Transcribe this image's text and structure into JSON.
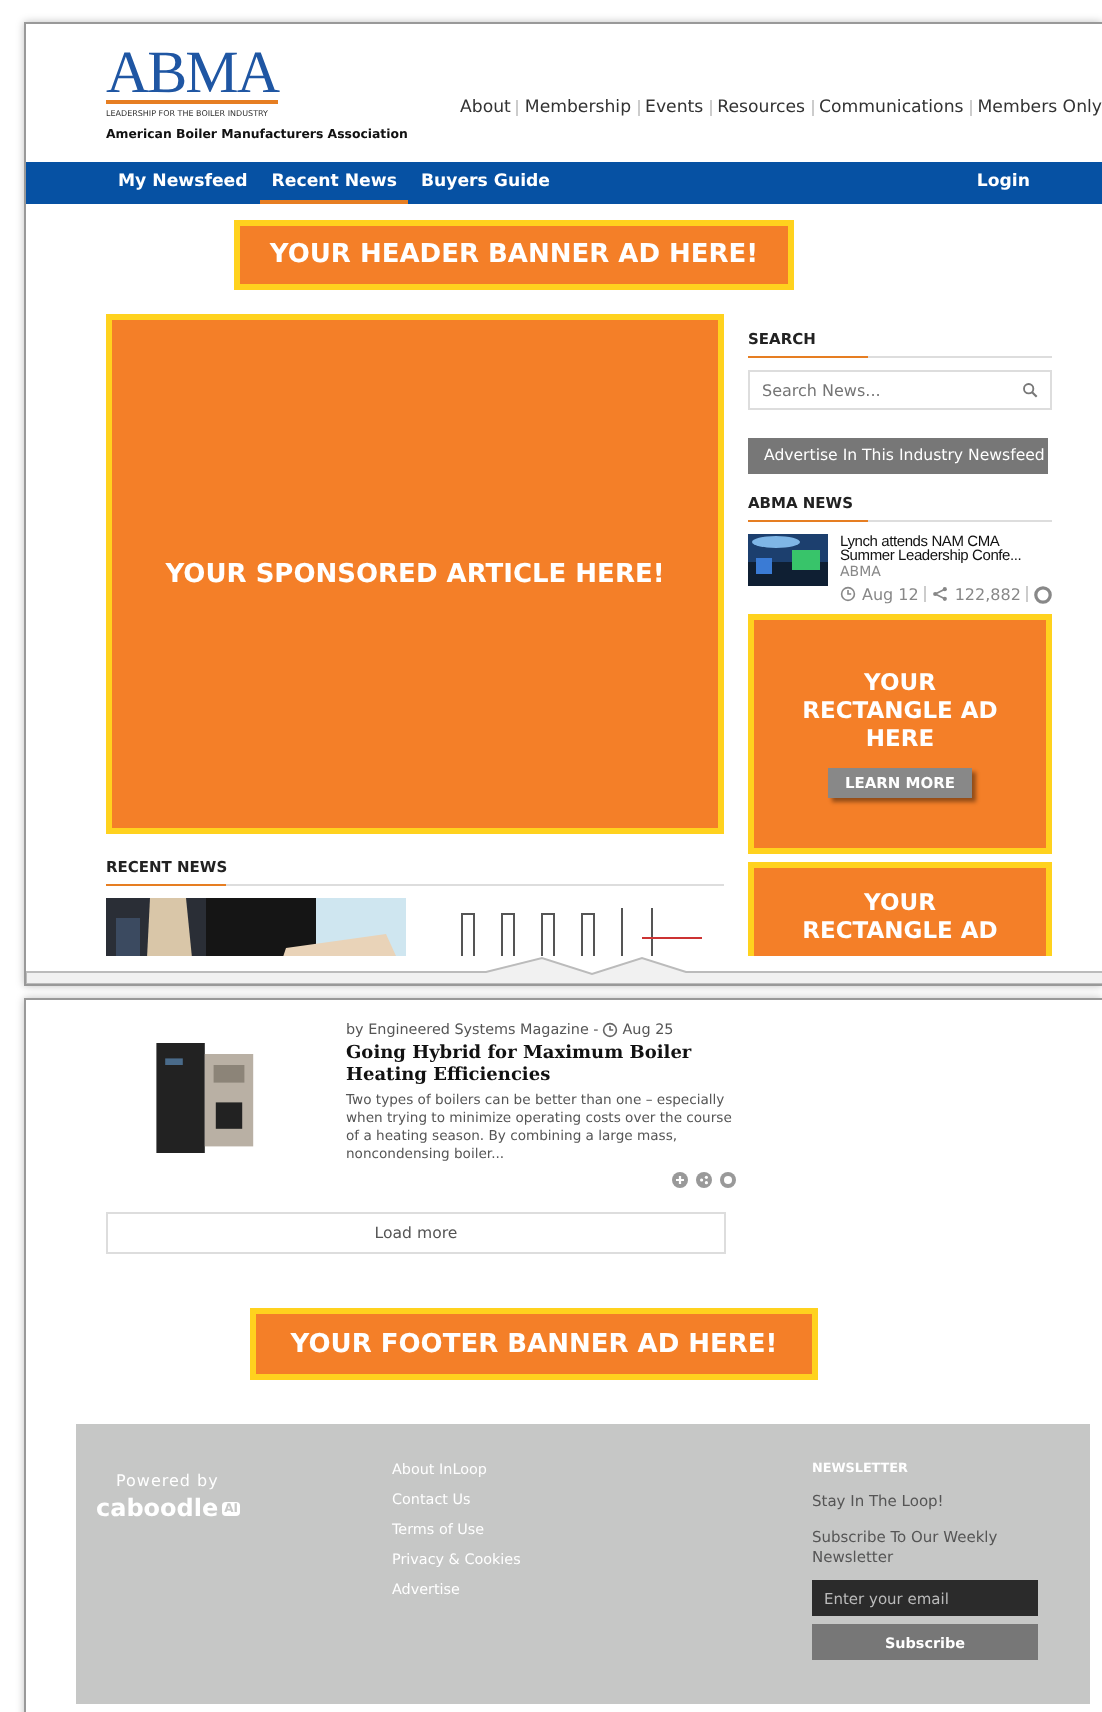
{
  "header": {
    "logo": {
      "letters": "ABMA",
      "tagline": "LEADERSHIP FOR THE BOILER INDUSTRY",
      "org": "American Boiler Manufacturers Association"
    },
    "links": [
      "About",
      "Membership",
      "Events",
      "Resources",
      "Communications",
      "Members Only"
    ]
  },
  "nav": {
    "items": [
      {
        "label": "My Newsfeed",
        "selected": false
      },
      {
        "label": "Recent News",
        "selected": true
      },
      {
        "label": "Buyers Guide",
        "selected": false
      }
    ],
    "login": "Login"
  },
  "header_ad": "YOUR HEADER BANNER AD HERE!",
  "sponsored_ad": "YOUR SPONSORED ARTICLE HERE!",
  "recent_news": {
    "title": "RECENT NEWS"
  },
  "sidebar": {
    "search": {
      "title": "SEARCH",
      "placeholder": "Search News..."
    },
    "advertise": "Advertise In This Industry Newsfeed",
    "abma_news": {
      "title": "ABMA NEWS",
      "item": {
        "headline": "Lynch attends NAM CMA Summer Leadership Confe...",
        "source": "ABMA",
        "date": "Aug 12",
        "shares": "122,882"
      }
    },
    "ads": [
      {
        "text": "YOUR RECTANGLE AD HERE",
        "button": "LEARN MORE"
      },
      {
        "text": "YOUR RECTANGLE AD"
      }
    ]
  },
  "article": {
    "byline": "by Engineered Systems Magazine - ",
    "date": "Aug 25",
    "title": "Going Hybrid for Maximum Boiler Heating Efficiencies",
    "excerpt": "Two types of boilers can be better than one – especially when trying to minimize operating costs over the course of a heating season. By combining a large mass, noncondensing boiler..."
  },
  "load_more": "Load more",
  "footer_ad": "YOUR FOOTER BANNER AD HERE!",
  "footer": {
    "powered_by": "Powered by",
    "brand": "caboodle",
    "brand_badge": "AI",
    "links": [
      "About InLoop",
      "Contact Us",
      "Terms of Use",
      "Privacy & Cookies",
      "Advertise"
    ],
    "newsletter": {
      "title": "NEWSLETTER",
      "tagline": "Stay In The Loop!",
      "text": "Subscribe To Our Weekly Newsletter",
      "placeholder": "Enter your email",
      "button": "Subscribe"
    }
  }
}
